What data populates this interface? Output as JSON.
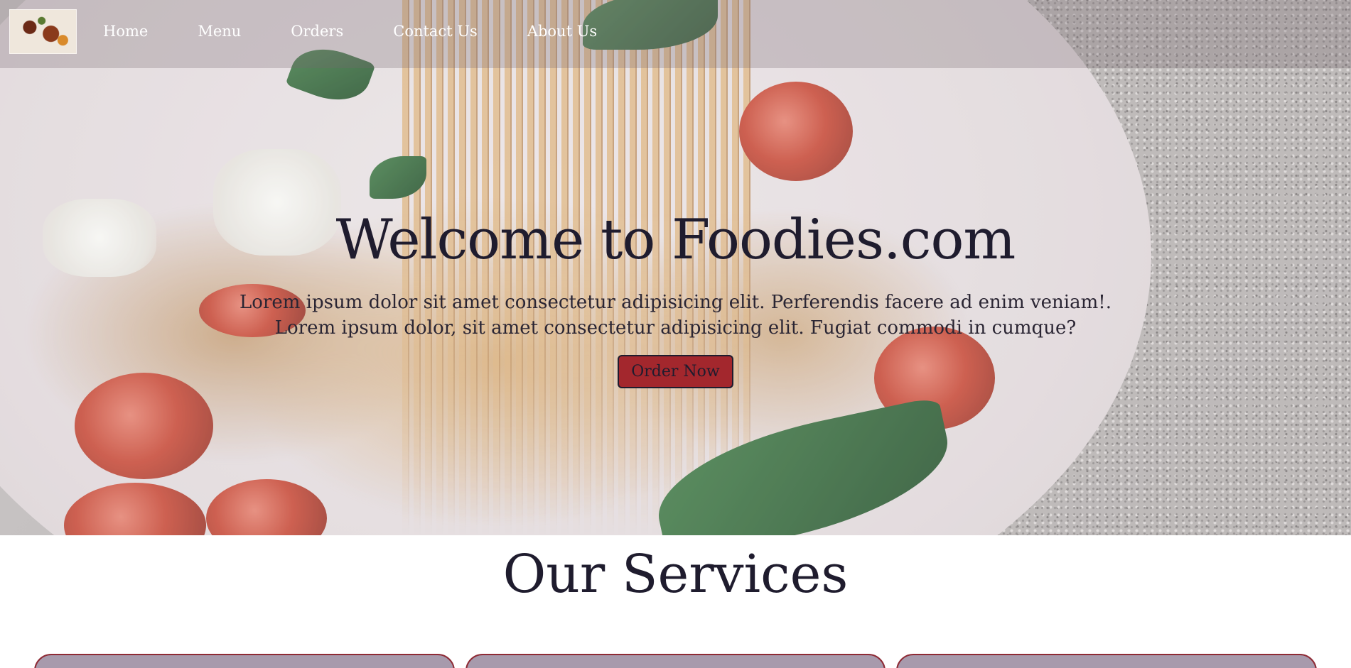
{
  "nav": {
    "logo_alt": "Foodies logo",
    "links": [
      "Home",
      "Menu",
      "Orders",
      "Contact Us",
      "About Us"
    ]
  },
  "hero": {
    "title": "Welcome to Foodies.com",
    "line1": "Lorem ipsum dolor sit amet consectetur adipisicing elit. Perferendis facere ad enim veniam!.",
    "line2": "Lorem ipsum dolor, sit amet consectetur adipisicing elit. Fugiat commodi in cumque?",
    "cta_label": "Order Now"
  },
  "services": {
    "title": "Our Services",
    "cards": [
      "",
      "",
      ""
    ]
  },
  "colors": {
    "cta": "#a3272d",
    "text_dark": "#1f1c2e",
    "card_fill": "#a79aac",
    "card_border": "#8e2a35"
  }
}
